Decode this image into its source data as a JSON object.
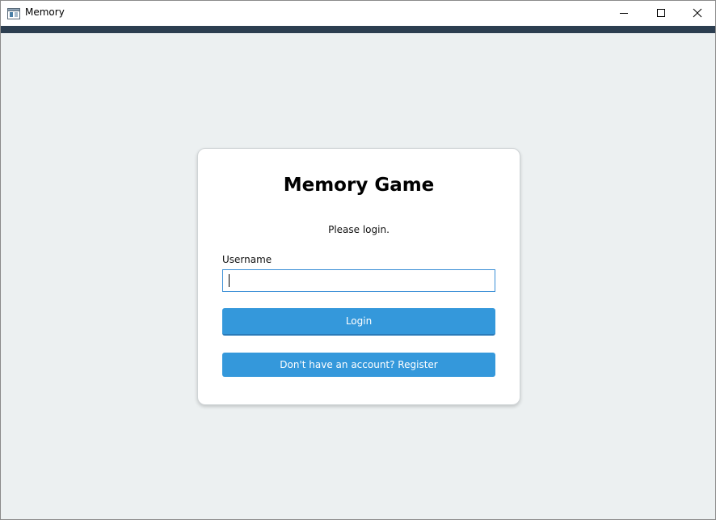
{
  "window": {
    "title": "Memory",
    "app_icon": "window-app-icon",
    "controls": {
      "minimize_icon": "minimize-icon",
      "maximize_icon": "maximize-icon",
      "close_icon": "close-icon"
    }
  },
  "colors": {
    "accent_strip": "#2c3e50",
    "background": "#ecf0f1",
    "card": "#ffffff",
    "button": "#3498db",
    "input_border": "#3a8fd6"
  },
  "login": {
    "title": "Memory Game",
    "subtitle": "Please login.",
    "username_label": "Username",
    "username_value": "",
    "login_button": "Login",
    "register_button": "Don't have an account? Register"
  }
}
